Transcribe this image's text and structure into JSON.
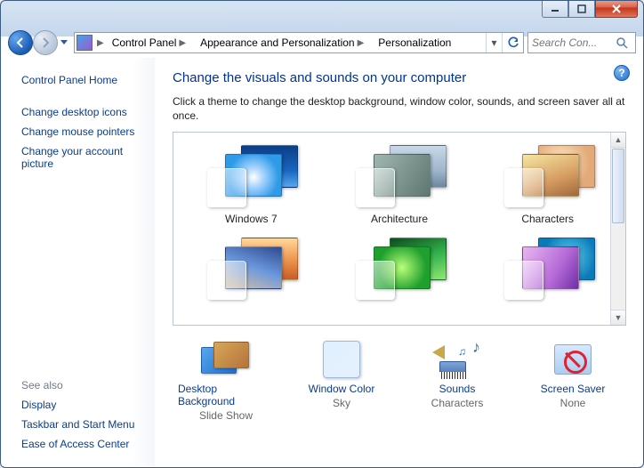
{
  "breadcrumb": {
    "seg1": "Control Panel",
    "seg2": "Appearance and Personalization",
    "seg3": "Personalization"
  },
  "search": {
    "placeholder": "Search Con..."
  },
  "sidebar": {
    "home": "Control Panel Home",
    "links": [
      "Change desktop icons",
      "Change mouse pointers",
      "Change your account picture"
    ],
    "seealso_label": "See also",
    "seealso": [
      "Display",
      "Taskbar and Start Menu",
      "Ease of Access Center"
    ]
  },
  "main": {
    "title": "Change the visuals and sounds on your computer",
    "desc": "Click a theme to change the desktop background, window color, sounds, and screen saver all at once."
  },
  "themes": {
    "row1": [
      "Windows 7",
      "Architecture",
      "Characters"
    ]
  },
  "options": {
    "desktop_bg": {
      "label": "Desktop Background",
      "value": "Slide Show"
    },
    "window_color": {
      "label": "Window Color",
      "value": "Sky"
    },
    "sounds": {
      "label": "Sounds",
      "value": "Characters"
    },
    "screen_saver": {
      "label": "Screen Saver",
      "value": "None"
    }
  }
}
